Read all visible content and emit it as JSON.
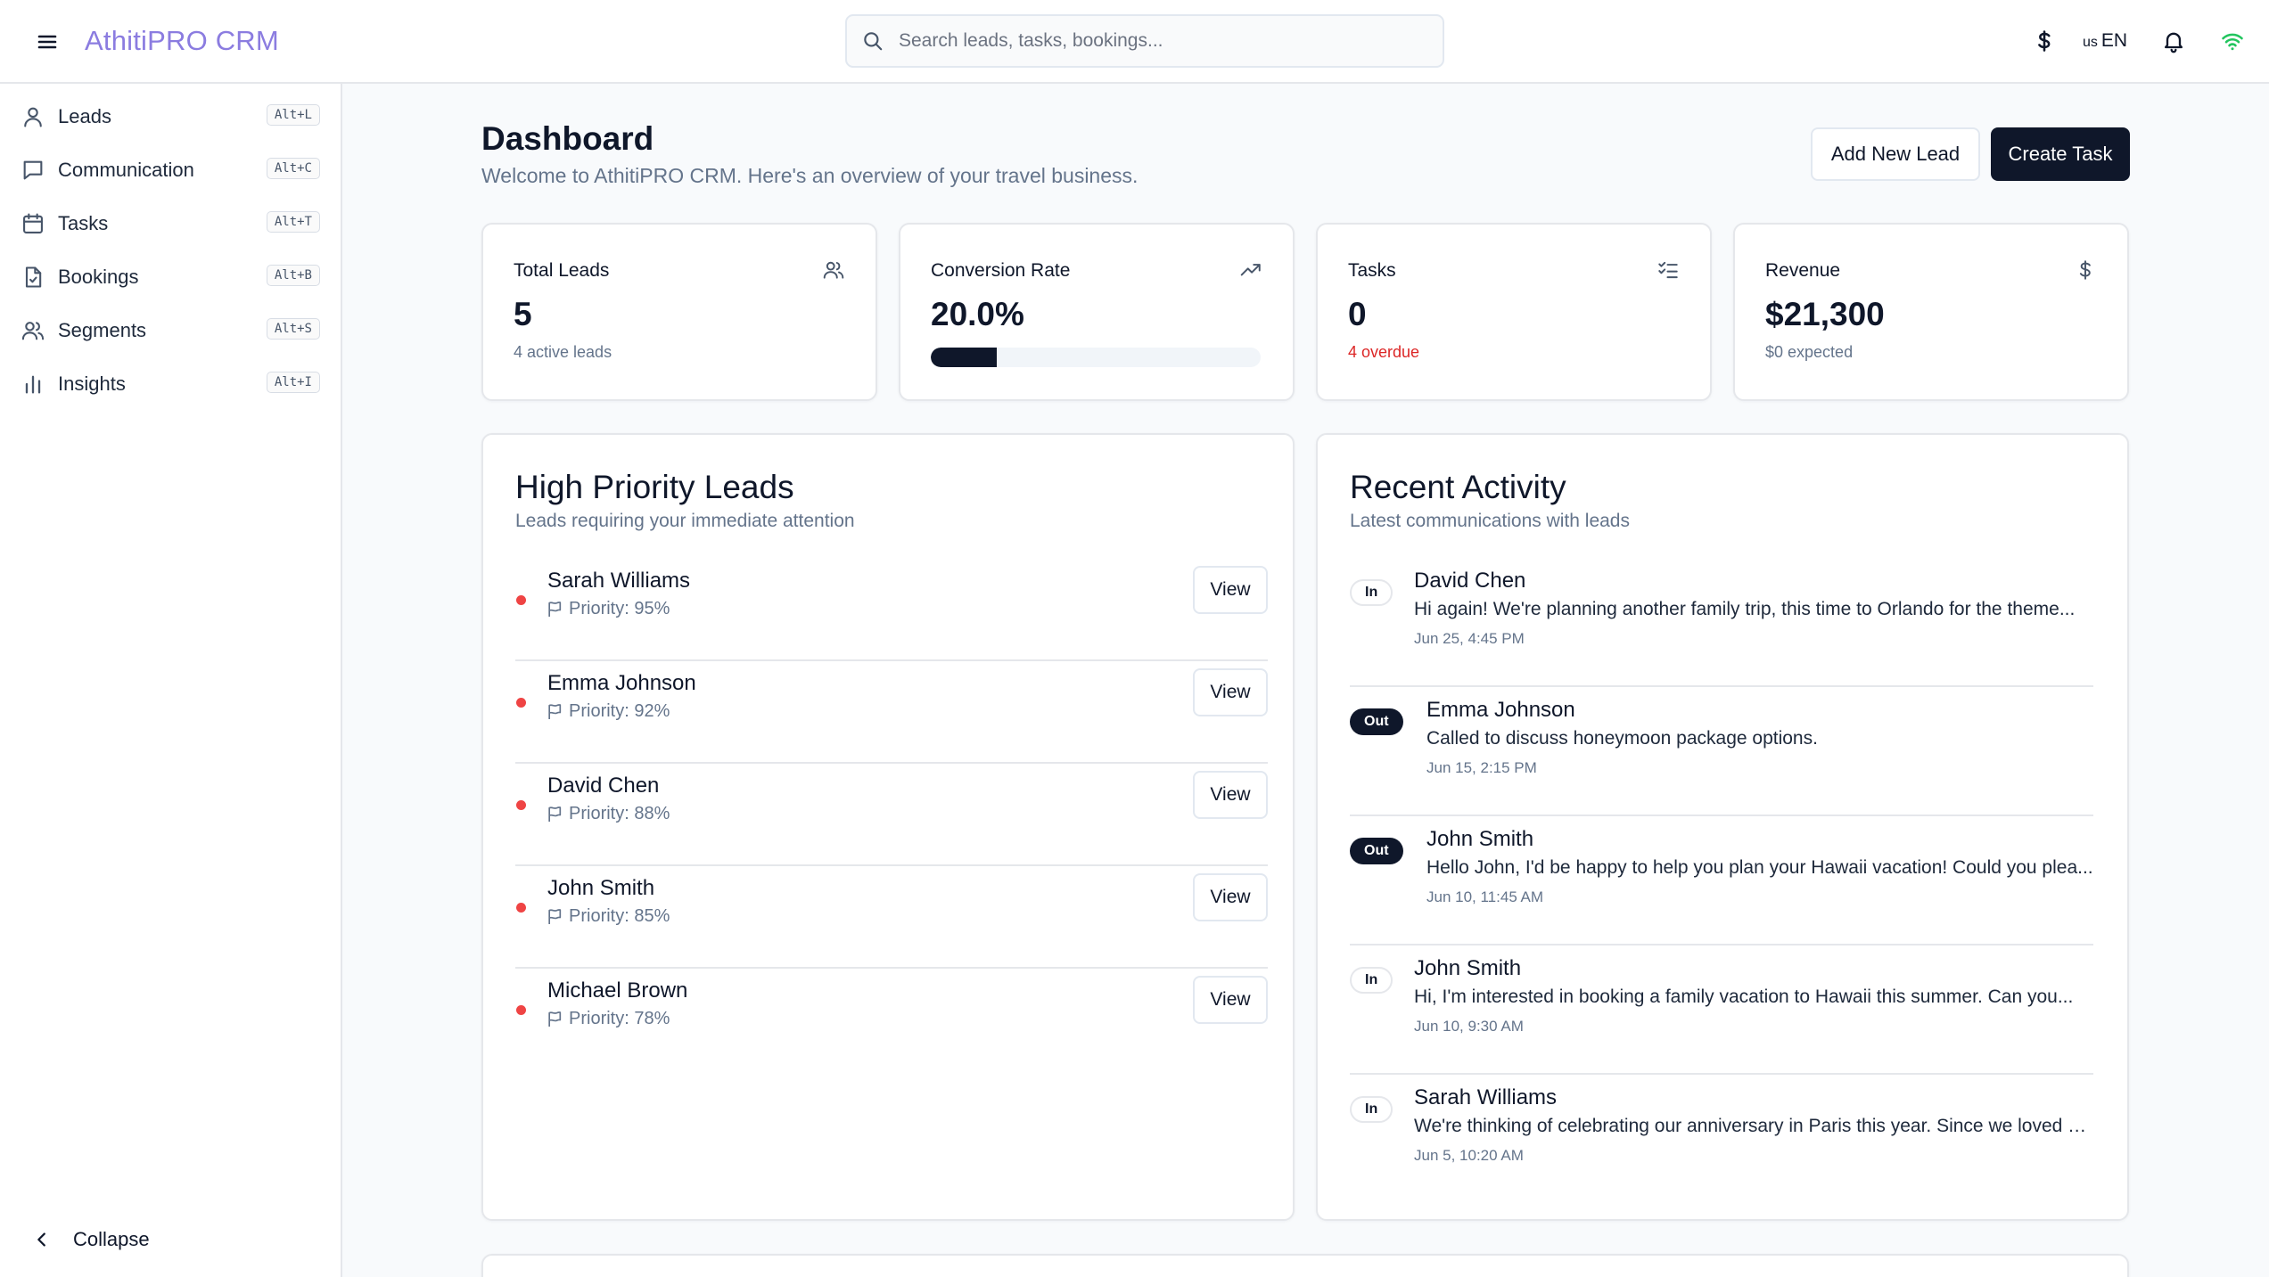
{
  "header": {
    "brand": "AthitiPRO CRM",
    "search_placeholder": "Search leads, tasks, bookings...",
    "language_flag": "us",
    "language_code": "EN"
  },
  "sidebar": {
    "items": [
      {
        "label": "Leads",
        "shortcut": "Alt+L",
        "icon": "user-icon"
      },
      {
        "label": "Communication",
        "shortcut": "Alt+C",
        "icon": "message-icon"
      },
      {
        "label": "Tasks",
        "shortcut": "Alt+T",
        "icon": "calendar-icon"
      },
      {
        "label": "Bookings",
        "shortcut": "Alt+B",
        "icon": "file-icon"
      },
      {
        "label": "Segments",
        "shortcut": "Alt+S",
        "icon": "users-icon"
      },
      {
        "label": "Insights",
        "shortcut": "Alt+I",
        "icon": "bar-chart-icon"
      }
    ],
    "collapse_label": "Collapse"
  },
  "main": {
    "title": "Dashboard",
    "subtitle": "Welcome to AthitiPRO CRM. Here's an overview of your travel business.",
    "add_lead_label": "Add New Lead",
    "create_task_label": "Create Task",
    "stats": {
      "total_leads": {
        "title": "Total Leads",
        "value": "5",
        "sub": "4 active leads"
      },
      "conversion": {
        "title": "Conversion Rate",
        "value": "20.0%",
        "progress": 0.2
      },
      "tasks": {
        "title": "Tasks",
        "value": "0",
        "sub": "4 overdue"
      },
      "revenue": {
        "title": "Revenue",
        "value": "$21,300",
        "sub": "$0 expected"
      }
    },
    "high_priority": {
      "title": "High Priority Leads",
      "subtitle": "Leads requiring your immediate attention",
      "view_label": "View",
      "leads": [
        {
          "name": "Sarah Williams",
          "priority": "Priority: 95%"
        },
        {
          "name": "Emma Johnson",
          "priority": "Priority: 92%"
        },
        {
          "name": "David Chen",
          "priority": "Priority: 88%"
        },
        {
          "name": "John Smith",
          "priority": "Priority: 85%"
        },
        {
          "name": "Michael Brown",
          "priority": "Priority: 78%"
        }
      ]
    },
    "recent_activity": {
      "title": "Recent Activity",
      "subtitle": "Latest communications with leads",
      "items": [
        {
          "direction": "In",
          "name": "David Chen",
          "message": "Hi again! We're planning another family trip, this time to Orlando for the theme...",
          "time": "Jun 25, 4:45 PM"
        },
        {
          "direction": "Out",
          "name": "Emma Johnson",
          "message": "Called to discuss honeymoon package options.",
          "time": "Jun 15, 2:15 PM"
        },
        {
          "direction": "Out",
          "name": "John Smith",
          "message": "Hello John, I'd be happy to help you plan your Hawaii vacation! Could you plea...",
          "time": "Jun 10, 11:45 AM"
        },
        {
          "direction": "In",
          "name": "John Smith",
          "message": "Hi, I'm interested in booking a family vacation to Hawaii this summer. Can you...",
          "time": "Jun 10, 9:30 AM"
        },
        {
          "direction": "In",
          "name": "Sarah Williams",
          "message": "We're thinking of celebrating our anniversary in Paris this year. Since we loved ou...",
          "time": "Jun 5, 10:20 AM"
        }
      ]
    }
  },
  "colors": {
    "brand": "#8b7ce0",
    "primary": "#0f172a",
    "priority_dot": "#ef4444",
    "overdue": "#dc2626",
    "wifi": "#22c55e"
  }
}
